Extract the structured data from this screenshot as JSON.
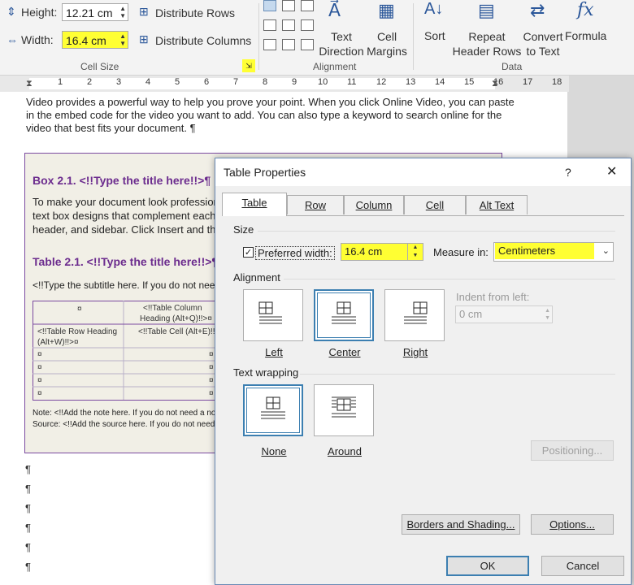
{
  "ribbon": {
    "height_label": "Height:",
    "height_value": "12.21 cm",
    "width_label": "Width:",
    "width_value": "16.4 cm",
    "distribute_rows": "Distribute Rows",
    "distribute_columns": "Distribute Columns",
    "cell_size_group": "Cell Size",
    "text_direction": [
      "Text",
      "Direction"
    ],
    "cell_margins": [
      "Cell",
      "Margins"
    ],
    "alignment_group": "Alignment",
    "sort": "Sort",
    "repeat_header_rows": [
      "Repeat",
      "Header Rows"
    ],
    "convert_to_text": [
      "Convert",
      "to Text"
    ],
    "formula": "Formula",
    "data_group": "Data",
    "highlight_color": "#ffff33"
  },
  "ruler": {
    "ticks": [
      "1",
      "2",
      "3",
      "4",
      "5",
      "6",
      "7",
      "8",
      "9",
      "10",
      "11",
      "12",
      "13",
      "14",
      "15",
      "16",
      "17",
      "18"
    ]
  },
  "document": {
    "intro_lines": [
      "Video provides a powerful way to help you prove your point. When you click Online Video, you can paste",
      "in the embed code for the video you want to add. You can also type a keyword to search online for the",
      "video that best fits your document. ¶"
    ],
    "box_title": "Box 2.1. <!!Type the title here!!>¶",
    "box_body": [
      "To make your document look profession",
      "text box designs that complement each",
      "header, and sidebar. Click Insert and the"
    ],
    "table_title": "Table 2.1. <!!Type the title here!!>¶",
    "subtitle": "<!!Type the subtitle here. If you do not need a",
    "table_header_col": [
      "<!!Table Column",
      "Heading (Alt+Q)!!>¤"
    ],
    "table_row_heading": [
      "<!!Table Row Heading",
      "(Alt+W)!!>¤"
    ],
    "table_cell": "<!!Table Cell (Alt+E)!!>¤",
    "cell_mark": "¤",
    "note": "Note: <!!Add the note here. If you do not need a note, p",
    "source": "Source: <!!Add the source here. If you do not need a s",
    "pilcrow": "¶"
  },
  "dialog": {
    "title": "Table Properties",
    "help": "?",
    "close": "✕",
    "tabs": [
      "Table",
      "Row",
      "Column",
      "Cell",
      "Alt Text"
    ],
    "active_tab": "Table",
    "size_section": "Size",
    "preferred_width_label": "Preferred width:",
    "preferred_width_checked": true,
    "preferred_width_value": "16.4 cm",
    "measure_in_label": "Measure in:",
    "measure_in_value": "Centimeters",
    "alignment_section": "Alignment",
    "alignment_options": [
      "Left",
      "Center",
      "Right"
    ],
    "alignment_selected": "Center",
    "indent_label": "Indent from left:",
    "indent_value": "0 cm",
    "wrapping_section": "Text wrapping",
    "wrapping_options": [
      "None",
      "Around"
    ],
    "wrapping_selected": "None",
    "positioning": "Positioning...",
    "borders_shading": "Borders and Shading...",
    "options": "Options...",
    "ok": "OK",
    "cancel": "Cancel",
    "accent_color": "#3c7fb1"
  }
}
